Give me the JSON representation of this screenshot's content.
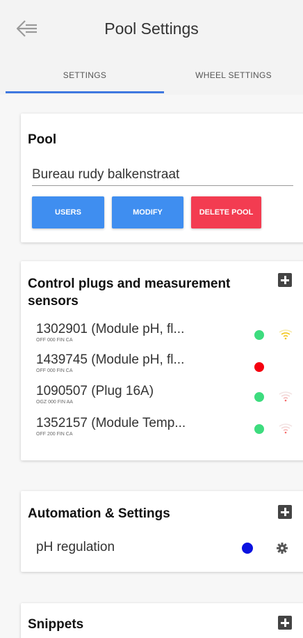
{
  "header": {
    "title": "Pool Settings",
    "back_icon": "arrow-left-icon"
  },
  "tabs": [
    {
      "label": "SETTINGS",
      "active": true
    },
    {
      "label": "WHEEL SETTINGS",
      "active": false
    }
  ],
  "pool_card": {
    "title": "Pool",
    "name_value": "Bureau rudy balkenstraat",
    "buttons": {
      "users": "USERS",
      "modify": "MODIFY",
      "delete": "DELETE POOL"
    }
  },
  "plugs_card": {
    "title_line1": "Control plugs and measurement",
    "title_line2": "sensors",
    "items": [
      {
        "main": "1302901 (Module pH, fl...",
        "sub": "OFF 000 FIN CA",
        "status": "green",
        "wifi": "yellow-wifi-icon"
      },
      {
        "main": "1439745 (Module pH, fl...",
        "sub": "OFF 000 FIN CA",
        "status": "red",
        "wifi": ""
      },
      {
        "main": "1090507 (Plug 16A)",
        "sub": "OGZ 000 FIN AA",
        "status": "green",
        "wifi": "red-wifi-icon"
      },
      {
        "main": "1352157 (Module Temp...",
        "sub": "OFF 200 FIN CA",
        "status": "green",
        "wifi": "red-wifi-icon"
      }
    ]
  },
  "automation_card": {
    "title": "Automation & Settings",
    "items": [
      {
        "label": "pH regulation",
        "status": "blue",
        "icon": "gear-icon"
      }
    ]
  },
  "snippets_card": {
    "title": "Snippets"
  },
  "colors": {
    "accent": "#3f78e0",
    "button_blue": "#3f8ef0",
    "button_red": "#f33c51",
    "status_green": "#3ddc7e",
    "status_red": "#f5000f",
    "status_blue": "#0b12e0",
    "wifi_yellow": "#f2c40f",
    "wifi_red": "#f56b6b"
  }
}
